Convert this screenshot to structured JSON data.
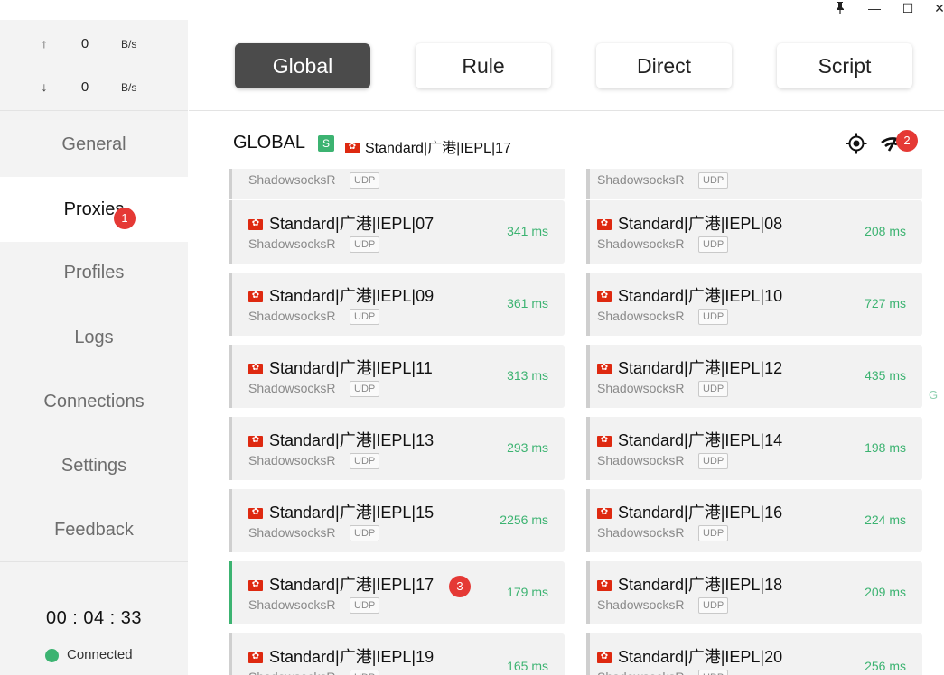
{
  "window": {
    "pin_icon": "pin-icon",
    "minimize_label": "—",
    "maximize_label": "☐",
    "close_label": "✕"
  },
  "traffic": {
    "up_arrow": "↑",
    "up_value": "0",
    "up_unit": "B/s",
    "down_arrow": "↓",
    "down_value": "0",
    "down_unit": "B/s"
  },
  "nav": {
    "general": "General",
    "proxies": "Proxies",
    "proxies_badge": "1",
    "profiles": "Profiles",
    "logs": "Logs",
    "connections": "Connections",
    "settings": "Settings",
    "feedback": "Feedback"
  },
  "status": {
    "timer": "00 : 04 : 33",
    "connection": "Connected",
    "color": "#3cb371"
  },
  "modes": {
    "global": "Global",
    "rule": "Rule",
    "direct": "Direct",
    "script": "Script",
    "active": "global"
  },
  "group": {
    "name": "GLOBAL",
    "type_badge": "S",
    "selected": "Standard|广港|IEPL|17",
    "speed_badge": "2"
  },
  "proxies": {
    "type_label": "ShadowsocksR",
    "udp_label": "UDP",
    "selected_badge": "3",
    "items": [
      {
        "name": "Standard|广港|IEPL|07",
        "delay": "341 ms"
      },
      {
        "name": "Standard|广港|IEPL|08",
        "delay": "208 ms"
      },
      {
        "name": "Standard|广港|IEPL|09",
        "delay": "361 ms"
      },
      {
        "name": "Standard|广港|IEPL|10",
        "delay": "727 ms"
      },
      {
        "name": "Standard|广港|IEPL|11",
        "delay": "313 ms"
      },
      {
        "name": "Standard|广港|IEPL|12",
        "delay": "435 ms"
      },
      {
        "name": "Standard|广港|IEPL|13",
        "delay": "293 ms"
      },
      {
        "name": "Standard|广港|IEPL|14",
        "delay": "198 ms"
      },
      {
        "name": "Standard|广港|IEPL|15",
        "delay": "2256 ms"
      },
      {
        "name": "Standard|广港|IEPL|16",
        "delay": "224 ms"
      },
      {
        "name": "Standard|广港|IEPL|17",
        "delay": "179 ms"
      },
      {
        "name": "Standard|广港|IEPL|18",
        "delay": "209 ms"
      },
      {
        "name": "Standard|广港|IEPL|19",
        "delay": "165 ms"
      },
      {
        "name": "Standard|广港|IEPL|20",
        "delay": "256 ms"
      }
    ]
  },
  "edge_mark": "G"
}
